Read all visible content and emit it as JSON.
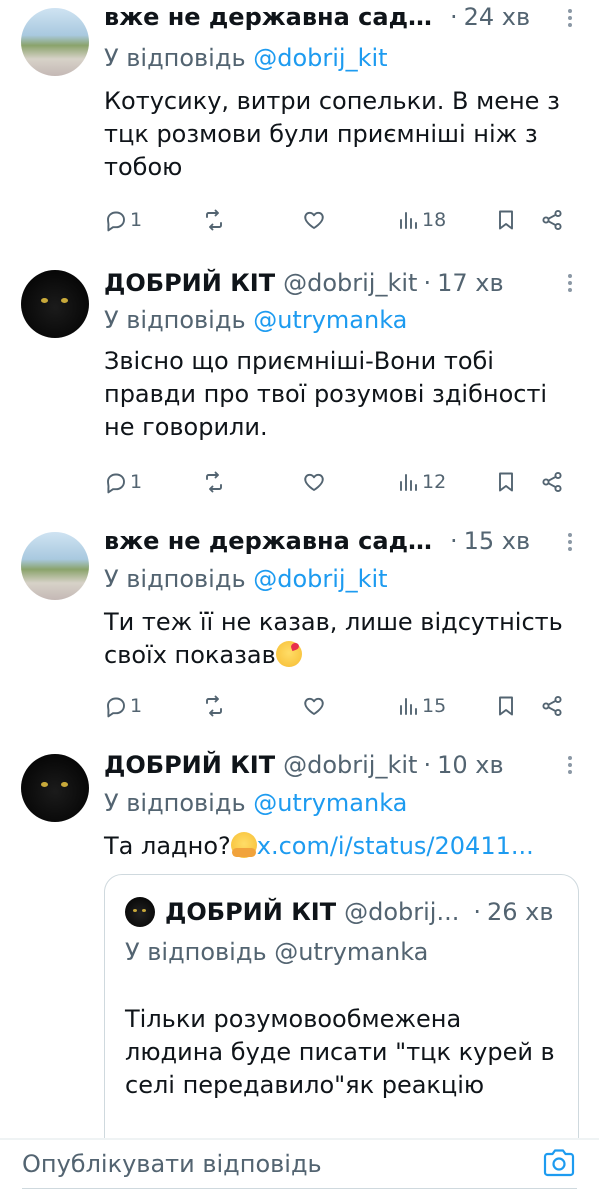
{
  "tweets": [
    {
      "name": "вже не державна садєр...",
      "handle": "",
      "time": "24 хв",
      "reply_prefix": "У відповідь ",
      "reply_mention": "@dobrij_kit",
      "text": "Котусику, витри сопельки. В мене з тцк розмови були приємніші ніж з тобою",
      "replies": "1",
      "views": "18"
    },
    {
      "name": "ДОБРИЙ КІТ",
      "handle": "@dobrij_kit",
      "time": "17 хв",
      "reply_prefix": "У відповідь ",
      "reply_mention": "@utrymanka",
      "text": "Звісно що приємніші-Вони тобі правди про твої розумові здібності не говорили.",
      "replies": "1",
      "views": "12"
    },
    {
      "name": "вже не державна садєр...",
      "handle": "",
      "time": "15 хв",
      "reply_prefix": "У відповідь ",
      "reply_mention": "@dobrij_kit",
      "text": "Ти теж її не казав, лише відсутність своїх показав",
      "replies": "1",
      "views": "15"
    },
    {
      "name": "ДОБРИЙ КІТ",
      "handle": "@dobrij_kit",
      "time": "10 хв",
      "reply_prefix": "У відповідь ",
      "reply_mention": "@utrymanka",
      "text": "Та ладно?",
      "link": "x.com/i/status/20411..."
    }
  ],
  "quote": {
    "name": "ДОБРИЙ КІТ",
    "handle": "@dobrij...",
    "time": "26 хв",
    "reply_line": "У відповідь @utrymanka",
    "text": "Тільки розумовообмежена людина буде писати \"тцк курей в селі  передавило\"як реакцію"
  },
  "composer": {
    "placeholder": "Опублікувати відповідь"
  },
  "separator": "·",
  "icons": {
    "reply": "reply-icon",
    "repost": "repost-icon",
    "like": "like-icon",
    "views": "views-icon",
    "bookmark": "bookmark-icon",
    "share": "share-icon",
    "camera": "camera-icon"
  },
  "colors": {
    "accent": "#1d9bf0",
    "secondary_text": "#536471",
    "primary_text": "#0f1419"
  }
}
